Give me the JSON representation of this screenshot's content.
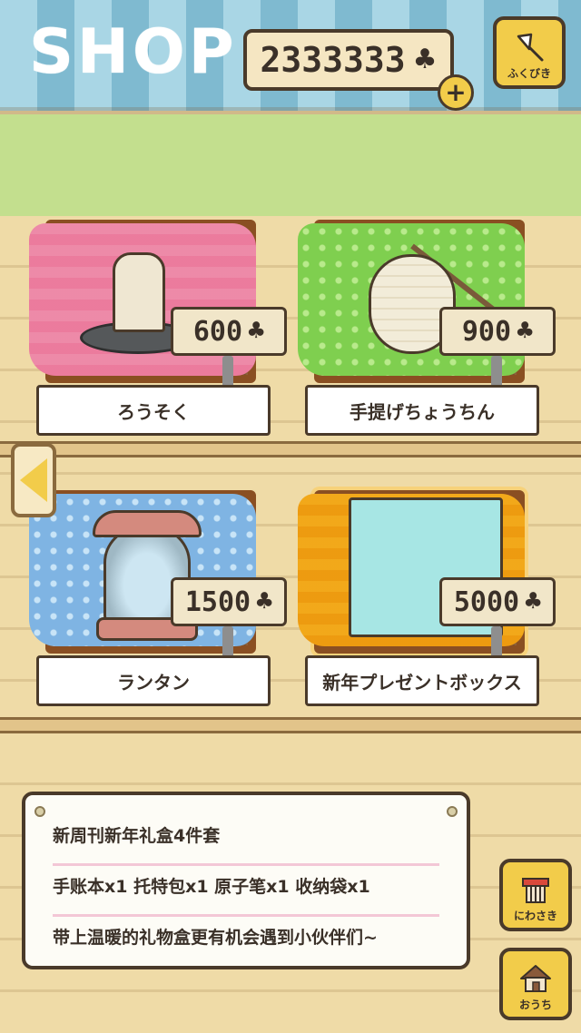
{
  "header": {
    "title": "SHOP",
    "clover_balance": "2333333",
    "clover_symbol": "♣",
    "add_clovers_label": "+",
    "lottery_button_label": "ふくびき"
  },
  "items": [
    {
      "name": "ろうそく",
      "price": "600",
      "cloth_color": "pink"
    },
    {
      "name": "手提げちょうちん",
      "price": "900",
      "cloth_color": "green"
    },
    {
      "name": "ランタン",
      "price": "1500",
      "cloth_color": "blue"
    },
    {
      "name": "新年プレゼントボックス",
      "price": "5000",
      "cloth_color": "yellow",
      "selected": true
    }
  ],
  "info_panel": {
    "lines": [
      "新周刊新年礼盒4件套",
      "手账本x1 托特包x1 原子笔x1 收纳袋x1",
      "带上温暖的礼物盒更有机会遇到小伙伴们~"
    ]
  },
  "side_buttons": {
    "garden_label": "にわさき",
    "home_label": "おうち"
  },
  "colors": {
    "awning_light": "#a9d6e5",
    "awning_dark": "#7fbad0",
    "button_yellow": "#f2cc4a",
    "outline": "#4a3a2a",
    "wood": "#efdba7"
  }
}
